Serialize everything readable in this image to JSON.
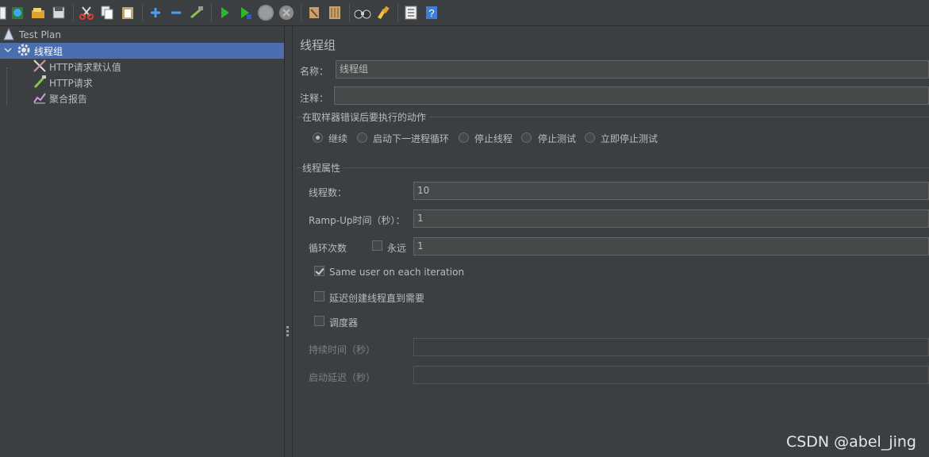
{
  "toolbar": {
    "icons": [
      "new-icon",
      "templates-icon",
      "open-icon",
      "save-icon",
      "cut-icon",
      "copy-icon",
      "paste-icon",
      "expand-icon",
      "collapse-icon",
      "toggle-icon",
      "start-icon",
      "start-no-pause-icon",
      "stop-icon",
      "shutdown-icon",
      "clear-icon",
      "clear-all-icon",
      "search-icon",
      "reset-search-icon",
      "function-helper-icon",
      "help-icon"
    ]
  },
  "tree": {
    "items": [
      {
        "label": "Test Plan",
        "icon": "test-plan-icon"
      },
      {
        "label": "线程组",
        "icon": "gear-icon"
      },
      {
        "label": "HTTP请求默认值",
        "icon": "config-element-icon"
      },
      {
        "label": "HTTP请求",
        "icon": "sampler-icon"
      },
      {
        "label": "聚合报告",
        "icon": "listener-icon"
      }
    ]
  },
  "panel": {
    "title": "线程组",
    "name_label": "名称：",
    "name_value": "线程组",
    "comment_label": "注释：",
    "comment_value": "",
    "error_group_title": "在取样器错误后要执行的动作",
    "error_actions": [
      {
        "label": "继续",
        "selected": true
      },
      {
        "label": "启动下一进程循环",
        "selected": false
      },
      {
        "label": "停止线程",
        "selected": false
      },
      {
        "label": "停止测试",
        "selected": false
      },
      {
        "label": "立即停止测试",
        "selected": false
      }
    ],
    "thread_group_title": "线程属性",
    "threads_label": "线程数：",
    "threads_value": "10",
    "rampup_label": "Ramp-Up时间（秒）：",
    "rampup_value": "1",
    "loop_label": "循环次数",
    "forever_label": "永远",
    "forever_checked": false,
    "loop_value": "1",
    "same_user_label": "Same user on each iteration",
    "same_user_checked": true,
    "delay_label": "延迟创建线程直到需要",
    "delay_checked": false,
    "scheduler_label": "调度器",
    "scheduler_checked": false,
    "duration_label": "持续时间（秒）",
    "duration_value": "",
    "startup_delay_label": "启动延迟（秒）",
    "startup_delay_value": ""
  },
  "watermark": "CSDN @abel_jing"
}
